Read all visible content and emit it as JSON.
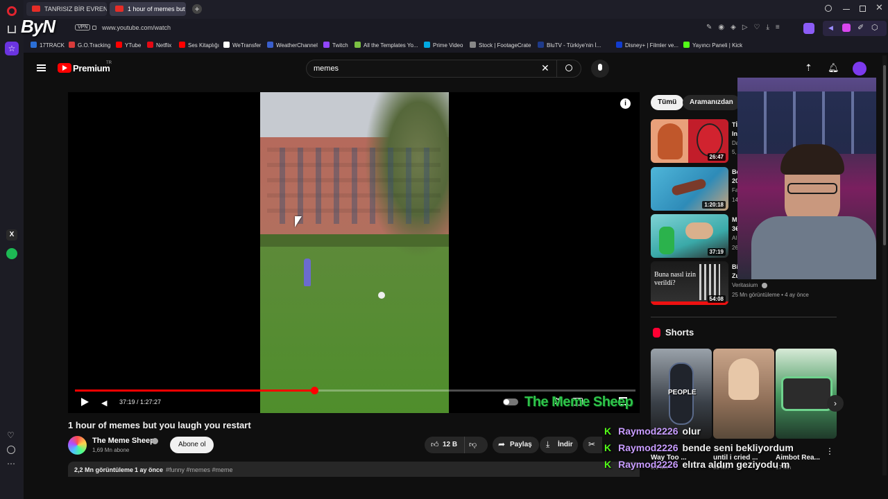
{
  "browser": {
    "tabs": [
      {
        "label": "TANRISIZ BİR EVREN | BLA"
      },
      {
        "label": "1 hour of memes but you"
      }
    ],
    "vpn_label": "VPN",
    "url": "www.youtube.com/watch",
    "logo_text": "ByN",
    "bookmarks": [
      {
        "label": "17TRACK",
        "color": "#2b6fd6"
      },
      {
        "label": "G.O.Tracking",
        "color": "#d83b3b"
      },
      {
        "label": "YTube",
        "color": "#ff0000"
      },
      {
        "label": "Netflix",
        "color": "#e50914"
      },
      {
        "label": "Ses Kitaplığı",
        "color": "#ff0000"
      },
      {
        "label": "WeTransfer",
        "color": "#ffffff"
      },
      {
        "label": "WeatherChannel",
        "color": "#3a5fcd"
      },
      {
        "label": "Twitch",
        "color": "#9146ff"
      },
      {
        "label": "All the Templates Yo...",
        "color": "#7bc043"
      },
      {
        "label": "Prime Video",
        "color": "#00a8e1"
      },
      {
        "label": "Stock | FootageCrate",
        "color": "#888888"
      },
      {
        "label": "BluTV - Türkiye'nin İ...",
        "color": "#1e3a8a"
      },
      {
        "label": "Disney+ | Filmler ve...",
        "color": "#113ccf"
      },
      {
        "label": "Yayıncı Paneli | Kick",
        "color": "#53fc18"
      }
    ]
  },
  "youtube": {
    "brand": "Premium",
    "country": "TR",
    "search_value": "memes",
    "player": {
      "time": "37:19 / 1:27:27",
      "progress": 0.427,
      "watermark": "The Meme Sheep"
    },
    "video": {
      "title": "1 hour of memes but you laugh you restart",
      "channel": "The Meme Sheep",
      "subscribers": "1,69 Mn abone",
      "subscribe_label": "Abone ol",
      "likes": "12 B",
      "share_label": "Paylaş",
      "download_label": "İndir",
      "views": "2,2 Mn görüntüleme",
      "age": "1 ay önce",
      "hashtags": "#funny #memes #meme"
    },
    "chips": [
      "Tümü",
      "Aramanızdan"
    ],
    "related": [
      {
        "duration": "26:47",
        "title": "Tİ In",
        "meta1": "Da",
        "meta2": "5,"
      },
      {
        "duration": "1:20:18",
        "title": "Bé 20",
        "meta1": "Fa",
        "meta2": "14"
      },
      {
        "duration": "37:19",
        "title": "M 3€",
        "meta1": "Al",
        "meta2": "26"
      },
      {
        "duration": "54:08",
        "title": "Bi Zu",
        "thumb_text": "Buna nasıl izin verildi?",
        "channel": "Veritasium",
        "meta2": "25 Mn görüntüleme • 4 ay önce"
      }
    ],
    "shorts": {
      "heading": "Shorts",
      "items": [
        {
          "title": "Way Too ...",
          "overlay": "PEOPLE",
          "views": "6,1 Mn"
        },
        {
          "title": "until i cried ...",
          "views": "39 Mn"
        },
        {
          "title": "Aimbot Rea...",
          "views": "17 Mn"
        }
      ]
    }
  },
  "chat": [
    {
      "user": "Raymod2226",
      "message": "olur"
    },
    {
      "user": "Raymod2226",
      "message": "bende seni bekliyordum"
    },
    {
      "user": "Raymod2226",
      "message": "elıtra aldım geziyodu m"
    }
  ]
}
